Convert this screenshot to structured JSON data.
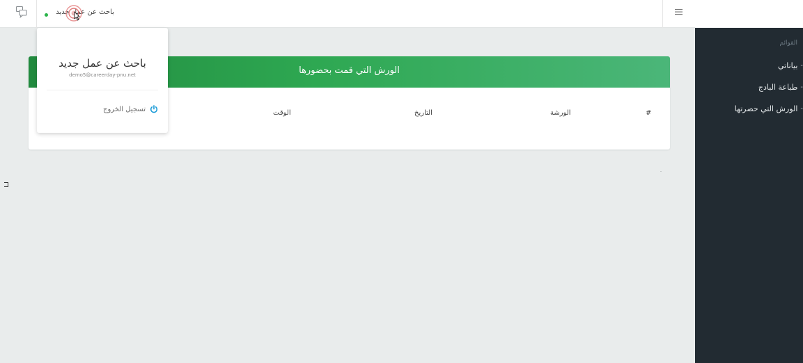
{
  "topbar": {
    "user_name": "باحث عن عمل جديد",
    "chat_icon": "chat-bubbles-icon",
    "menu_icon": "hamburger-menu-icon"
  },
  "user_menu": {
    "name": "باحث عن عمل جديد",
    "email": "demo5@careerday-pnu.net",
    "logout_label": "تسجيل الخروج",
    "logout_icon": "power-icon"
  },
  "sidebar": {
    "heading": "القوائم",
    "items": [
      {
        "label": "بياناتي"
      },
      {
        "label": "طباعة البادج"
      },
      {
        "label": "الورش التي حضرتها"
      }
    ]
  },
  "main": {
    "card_title": "الورش التي قمت بحضورها",
    "table": {
      "columns": [
        "#",
        "الورشة",
        "التاريخ",
        "الوقت"
      ]
    }
  },
  "colors": {
    "sidebar_bg": "#222b32",
    "header_green": "#2ea852",
    "online": "#2ab44a",
    "power_icon": "#1a9bd7"
  }
}
